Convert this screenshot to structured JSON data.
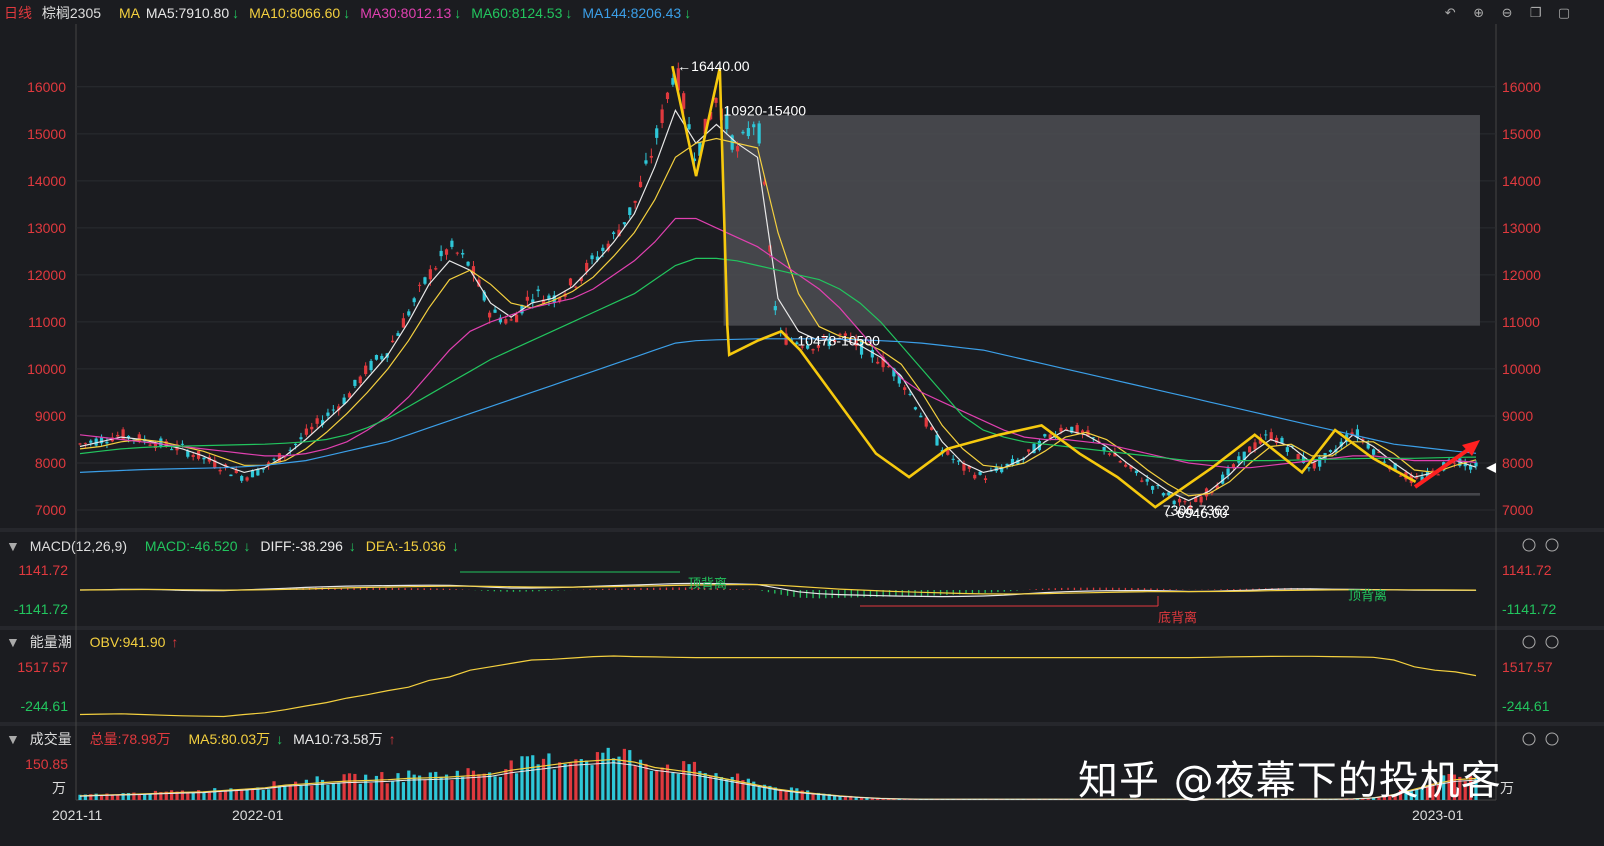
{
  "symbol": {
    "period": "日线",
    "name": "棕榈2305"
  },
  "ma_header": {
    "label": "MA",
    "items": [
      {
        "text": "MA5:7910.80",
        "color": "#e8e8e8",
        "arrow": "down"
      },
      {
        "text": "MA10:8066.60",
        "color": "#f4d03f",
        "arrow": "down"
      },
      {
        "text": "MA30:8012.13",
        "color": "#e040b0",
        "arrow": "down"
      },
      {
        "text": "MA60:8124.53",
        "color": "#22c55e",
        "arrow": "down"
      },
      {
        "text": "MA144:8206.43",
        "color": "#3b9fe8",
        "arrow": "down"
      }
    ]
  },
  "toolbar_icons": [
    "undo-icon",
    "zoom-in-icon",
    "zoom-out-icon",
    "window-icon",
    "fullscreen-icon"
  ],
  "macd_header": {
    "title": "MACD(12,26,9)",
    "macd": "MACD:-46.520",
    "diff": "DIFF:-38.296",
    "dea": "DEA:-15.036"
  },
  "obv_header": {
    "title": "能量潮",
    "obv": "OBV:941.90"
  },
  "vol_header": {
    "title": "成交量",
    "total": "总量:78.98万",
    "ma5": "MA5:80.03万",
    "ma10": "MA10:73.58万"
  },
  "watermark": "知乎 @夜幕下的投机客",
  "colors": {
    "up": "#e0393e",
    "down": "#2ec7d8",
    "ma5": "#e8e8e8",
    "ma10": "#f4d03f",
    "ma30": "#e040b0",
    "ma60": "#22c55e",
    "ma144": "#3b9fe8",
    "zigzag": "#f6c90e",
    "zone": "#4a4b50"
  },
  "chart_data": [
    {
      "type": "line",
      "panel": "price",
      "ylim": [
        7000,
        16400
      ],
      "yticks": [
        "16000",
        "15000",
        "14000",
        "13000",
        "12000",
        "11000",
        "10000",
        "9000",
        "8000",
        "7000"
      ],
      "xticks": [
        "2021-11",
        "2022-01",
        "2023-01"
      ],
      "close_series": [
        8400,
        8500,
        8600,
        8500,
        8400,
        8300,
        8100,
        7900,
        7700,
        7900,
        8200,
        8600,
        9000,
        9400,
        10000,
        10400,
        11200,
        12000,
        12600,
        12200,
        11200,
        11000,
        11600,
        11500,
        11800,
        12300,
        12800,
        13500,
        14800,
        16440,
        14500,
        15800,
        14600,
        15400,
        10700,
        10600,
        10500,
        10700,
        10478,
        10200,
        9800,
        9000,
        8300,
        7900,
        7700,
        7900,
        8100,
        8500,
        8800,
        8600,
        8300,
        7900,
        7600,
        7300,
        7062,
        7400,
        7800,
        8300,
        8600,
        8300,
        7900,
        8200,
        8700,
        8300,
        7900,
        7600,
        7800,
        8100,
        7900
      ],
      "series": [
        {
          "name": "MA5",
          "values": [
            8350,
            8450,
            8550,
            8500,
            8400,
            8300,
            8150,
            7950,
            7800,
            7900,
            8150,
            8500,
            8900,
            9300,
            9800,
            10300,
            11000,
            11800,
            12300,
            12100,
            11400,
            11100,
            11400,
            11500,
            11750,
            12200,
            12700,
            13300,
            14300,
            15500,
            14800,
            15200,
            14800,
            14500,
            11500,
            10800,
            10600,
            10650,
            10500,
            10250,
            9850,
            9150,
            8450,
            8000,
            7800,
            7900,
            8100,
            8450,
            8700,
            8600,
            8350,
            8000,
            7700,
            7400,
            7200,
            7400,
            7750,
            8200,
            8500,
            8350,
            8000,
            8200,
            8600,
            8350,
            8000,
            7700,
            7800,
            8050,
            7911
          ]
        },
        {
          "name": "MA10",
          "values": [
            8300,
            8350,
            8450,
            8500,
            8450,
            8350,
            8250,
            8100,
            7950,
            7950,
            8050,
            8300,
            8650,
            9050,
            9500,
            10000,
            10600,
            11300,
            11900,
            12100,
            11800,
            11400,
            11300,
            11450,
            11650,
            11950,
            12400,
            12900,
            13600,
            14500,
            14800,
            14900,
            14800,
            14700,
            12900,
            11600,
            10900,
            10700,
            10600,
            10400,
            10100,
            9500,
            8800,
            8300,
            7950,
            7900,
            8000,
            8250,
            8550,
            8650,
            8500,
            8200,
            7850,
            7550,
            7300,
            7350,
            7600,
            8000,
            8350,
            8400,
            8150,
            8150,
            8450,
            8450,
            8200,
            7850,
            7800,
            7950,
            8067
          ]
        },
        {
          "name": "MA30",
          "values": [
            8600,
            8550,
            8500,
            8450,
            8400,
            8350,
            8300,
            8250,
            8200,
            8150,
            8150,
            8200,
            8300,
            8450,
            8700,
            9000,
            9400,
            9900,
            10400,
            10800,
            11000,
            11150,
            11300,
            11400,
            11500,
            11700,
            12000,
            12300,
            12700,
            13200,
            13200,
            13000,
            12800,
            12600,
            12300,
            12000,
            11700,
            11300,
            10800,
            10300,
            9800,
            9500,
            9300,
            9100,
            8900,
            8700,
            8550,
            8500,
            8500,
            8450,
            8400,
            8300,
            8200,
            8100,
            8000,
            7950,
            7900,
            7900,
            7950,
            8000,
            8050,
            8100,
            8150,
            8150,
            8100,
            8050,
            8050,
            8050,
            8012
          ]
        },
        {
          "name": "MA60",
          "values": [
            8200,
            8250,
            8300,
            8330,
            8350,
            8360,
            8370,
            8380,
            8390,
            8400,
            8420,
            8450,
            8500,
            8600,
            8750,
            8950,
            9200,
            9450,
            9700,
            9950,
            10200,
            10400,
            10600,
            10800,
            11000,
            11200,
            11400,
            11600,
            11900,
            12200,
            12350,
            12350,
            12300,
            12200,
            12100,
            12000,
            11900,
            11700,
            11400,
            11000,
            10500,
            10000,
            9500,
            9000,
            8700,
            8550,
            8450,
            8400,
            8350,
            8300,
            8250,
            8200,
            8150,
            8100,
            8050,
            8050,
            8050,
            8050,
            8050,
            8060,
            8070,
            8080,
            8090,
            8100,
            8100,
            8100,
            8110,
            8120,
            8125
          ]
        },
        {
          "name": "MA144",
          "values": [
            7800,
            7820,
            7840,
            7860,
            7870,
            7880,
            7890,
            7900,
            7920,
            7950,
            8000,
            8050,
            8150,
            8250,
            8350,
            8450,
            8600,
            8750,
            8900,
            9050,
            9200,
            9350,
            9500,
            9650,
            9800,
            9950,
            10100,
            10250,
            10400,
            10550,
            10600,
            10620,
            10630,
            10640,
            10640,
            10640,
            10640,
            10630,
            10620,
            10600,
            10580,
            10550,
            10500,
            10450,
            10400,
            10300,
            10200,
            10100,
            10000,
            9900,
            9800,
            9700,
            9600,
            9500,
            9400,
            9300,
            9200,
            9100,
            9000,
            8900,
            8800,
            8700,
            8600,
            8500,
            8400,
            8350,
            8300,
            8250,
            8206
          ]
        }
      ],
      "zigzag": [
        [
          0.63,
          16440
        ],
        [
          0.655,
          14100
        ],
        [
          0.68,
          16400
        ],
        [
          0.688,
          10920
        ],
        [
          0.69,
          10300
        ],
        [
          0.72,
          10600
        ],
        [
          0.745,
          10800
        ],
        [
          0.765,
          10400
        ],
        [
          0.845,
          8200
        ],
        [
          0.88,
          7700
        ],
        [
          0.92,
          8300
        ],
        [
          0.975,
          8600
        ],
        [
          1.02,
          8800
        ],
        [
          1.06,
          8200
        ],
        [
          1.1,
          7700
        ],
        [
          1.14,
          7062
        ],
        [
          1.2,
          7900
        ],
        [
          1.245,
          8600
        ],
        [
          1.295,
          7800
        ],
        [
          1.33,
          8700
        ],
        [
          1.37,
          8100
        ],
        [
          1.415,
          7600
        ]
      ],
      "annotations": [
        {
          "text": "←16440.00",
          "x": 0.635,
          "y": 16440
        },
        {
          "text": "10920-15400",
          "x": 0.684,
          "y": 15500
        },
        {
          "text": "10478-10500",
          "x": 0.762,
          "y": 10600
        },
        {
          "text": "7306-7362",
          "x": 1.148,
          "y": 7000
        },
        {
          "text": "←6946.00",
          "x": 1.148,
          "y": 6940
        }
      ],
      "zones": [
        {
          "from_x": 0.684,
          "to_x": 1.483,
          "low": 10920,
          "high": 15400
        },
        {
          "from_x": 1.148,
          "to_x": 1.483,
          "low": 7306,
          "high": 7362
        }
      ]
    },
    {
      "type": "line",
      "panel": "macd",
      "ylim": [
        -1141.72,
        1141.72
      ],
      "yticks": [
        "1141.72",
        "-1141.72"
      ],
      "series": [
        {
          "name": "DIFF",
          "values": [
            0,
            20,
            60,
            80,
            40,
            -40,
            -80,
            -60,
            20,
            100,
            180,
            280,
            360,
            420,
            460,
            480,
            500,
            520,
            500,
            420,
            300,
            220,
            220,
            260,
            320,
            400,
            480,
            540,
            620,
            700,
            720,
            700,
            650,
            600,
            200,
            -200,
            -400,
            -500,
            -550,
            -620,
            -660,
            -700,
            -720,
            -700,
            -650,
            -560,
            -420,
            -280,
            -180,
            -120,
            -80,
            -60,
            -50,
            -100,
            -160,
            -140,
            -80,
            -20,
            60,
            120,
            120,
            90,
            60,
            40,
            20,
            -20,
            -30,
            -38,
            -38
          ]
        },
        {
          "name": "DEA",
          "values": [
            0,
            10,
            30,
            50,
            55,
            35,
            10,
            -10,
            -5,
            20,
            60,
            110,
            170,
            230,
            280,
            320,
            360,
            390,
            410,
            410,
            390,
            360,
            330,
            320,
            320,
            340,
            370,
            410,
            450,
            500,
            540,
            570,
            590,
            590,
            520,
            380,
            240,
            100,
            0,
            -100,
            -180,
            -250,
            -320,
            -380,
            -420,
            -430,
            -420,
            -390,
            -350,
            -300,
            -260,
            -220,
            -190,
            -170,
            -170,
            -165,
            -150,
            -120,
            -80,
            -40,
            -10,
            10,
            20,
            25,
            25,
            20,
            10,
            -5,
            -15
          ]
        }
      ],
      "labels": [
        {
          "text": "顶背离",
          "color": "#22c55e"
        },
        {
          "text": "底背离",
          "color": "#e0393e"
        },
        {
          "text": "顶背离",
          "color": "#22c55e"
        }
      ]
    },
    {
      "type": "line",
      "panel": "obv",
      "ylim": [
        -244.61,
        1517.57
      ],
      "yticks": [
        "1517.57",
        "-244.61"
      ],
      "series": [
        {
          "name": "OBV",
          "values": [
            -200,
            -190,
            -180,
            -200,
            -220,
            -240,
            -250,
            -260,
            -200,
            -150,
            -60,
            50,
            150,
            280,
            380,
            500,
            600,
            800,
            900,
            1100,
            1200,
            1300,
            1400,
            1420,
            1460,
            1500,
            1517,
            1500,
            1490,
            1480,
            1470,
            1470,
            1470,
            1470,
            1470,
            1470,
            1470,
            1470,
            1470,
            1470,
            1470,
            1470,
            1470,
            1470,
            1470,
            1470,
            1470,
            1470,
            1470,
            1470,
            1470,
            1470,
            1470,
            1470,
            1470,
            1480,
            1490,
            1500,
            1505,
            1510,
            1510,
            1500,
            1490,
            1480,
            1400,
            1200,
            1100,
            1050,
            942
          ]
        }
      ]
    },
    {
      "type": "bar",
      "panel": "volume",
      "ylim": [
        0,
        150.85
      ],
      "yticks": [
        "150.85",
        "万"
      ],
      "values": [
        15,
        18,
        20,
        22,
        25,
        28,
        30,
        35,
        40,
        45,
        55,
        60,
        65,
        70,
        72,
        75,
        80,
        82,
        85,
        90,
        95,
        110,
        120,
        130,
        140,
        145,
        150,
        140,
        120,
        110,
        100,
        85,
        70,
        55,
        40,
        30,
        22,
        15,
        10,
        6,
        4,
        3,
        3,
        3,
        3,
        3,
        3,
        3,
        3,
        3,
        3,
        3,
        3,
        3,
        3,
        3,
        3,
        3,
        3,
        3,
        3,
        3,
        4,
        8,
        20,
        40,
        60,
        75,
        80
      ]
    }
  ]
}
